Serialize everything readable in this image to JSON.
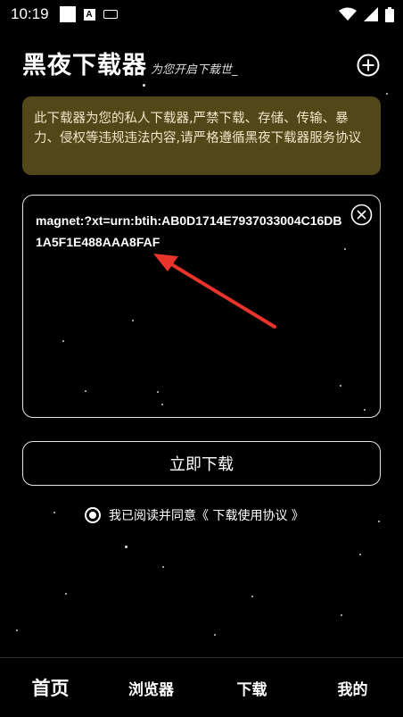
{
  "status_bar": {
    "time": "10:19",
    "icons": [
      "square-icon",
      "a-badge-icon",
      "keyboard-icon",
      "wifi-icon",
      "signal-icon",
      "battery-icon"
    ],
    "a_badge": "A"
  },
  "header": {
    "title": "黑夜下载器",
    "subtitle": "为您开启下载世_",
    "add_icon": "plus-circle-icon"
  },
  "notice": {
    "text": "此下载器为您的私人下载器,严禁下载、存储、传输、暴力、侵权等违规违法内容,请严格遵循黑夜下载器服务协议"
  },
  "link_input": {
    "value": "magnet:?xt=urn:btih:AB0D1714E7937033004C16DB1A5F1E488AAA8FAF",
    "clear_icon": "close-circle-icon"
  },
  "download_button": {
    "label": "立即下载"
  },
  "agreement": {
    "checked": true,
    "text": "我已阅读并同意《 下载使用协议 》"
  },
  "bottom_nav": {
    "items": [
      {
        "label": "首页",
        "active": true
      },
      {
        "label": "浏览器",
        "active": false
      },
      {
        "label": "下载",
        "active": false
      },
      {
        "label": "我的",
        "active": false
      }
    ]
  },
  "colors": {
    "background": "#000000",
    "notice_bg": "#514718",
    "annotation_arrow": "#e8342a"
  }
}
